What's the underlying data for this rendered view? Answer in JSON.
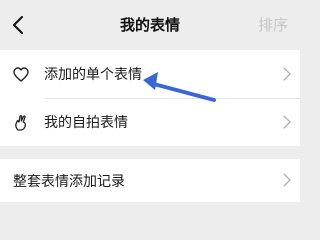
{
  "header": {
    "title": "我的表情",
    "sort_label": "排序",
    "back_icon": "chevron-left-icon"
  },
  "list_main": {
    "items": [
      {
        "label": "添加的单个表情",
        "icon": "heart-outline-icon"
      },
      {
        "label": "我的自拍表情",
        "icon": "hand-gesture-icon"
      }
    ]
  },
  "list_secondary": {
    "items": [
      {
        "label": "整套表情添加记录"
      }
    ]
  },
  "annotation": {
    "arrow_color": "#3a66d6"
  }
}
